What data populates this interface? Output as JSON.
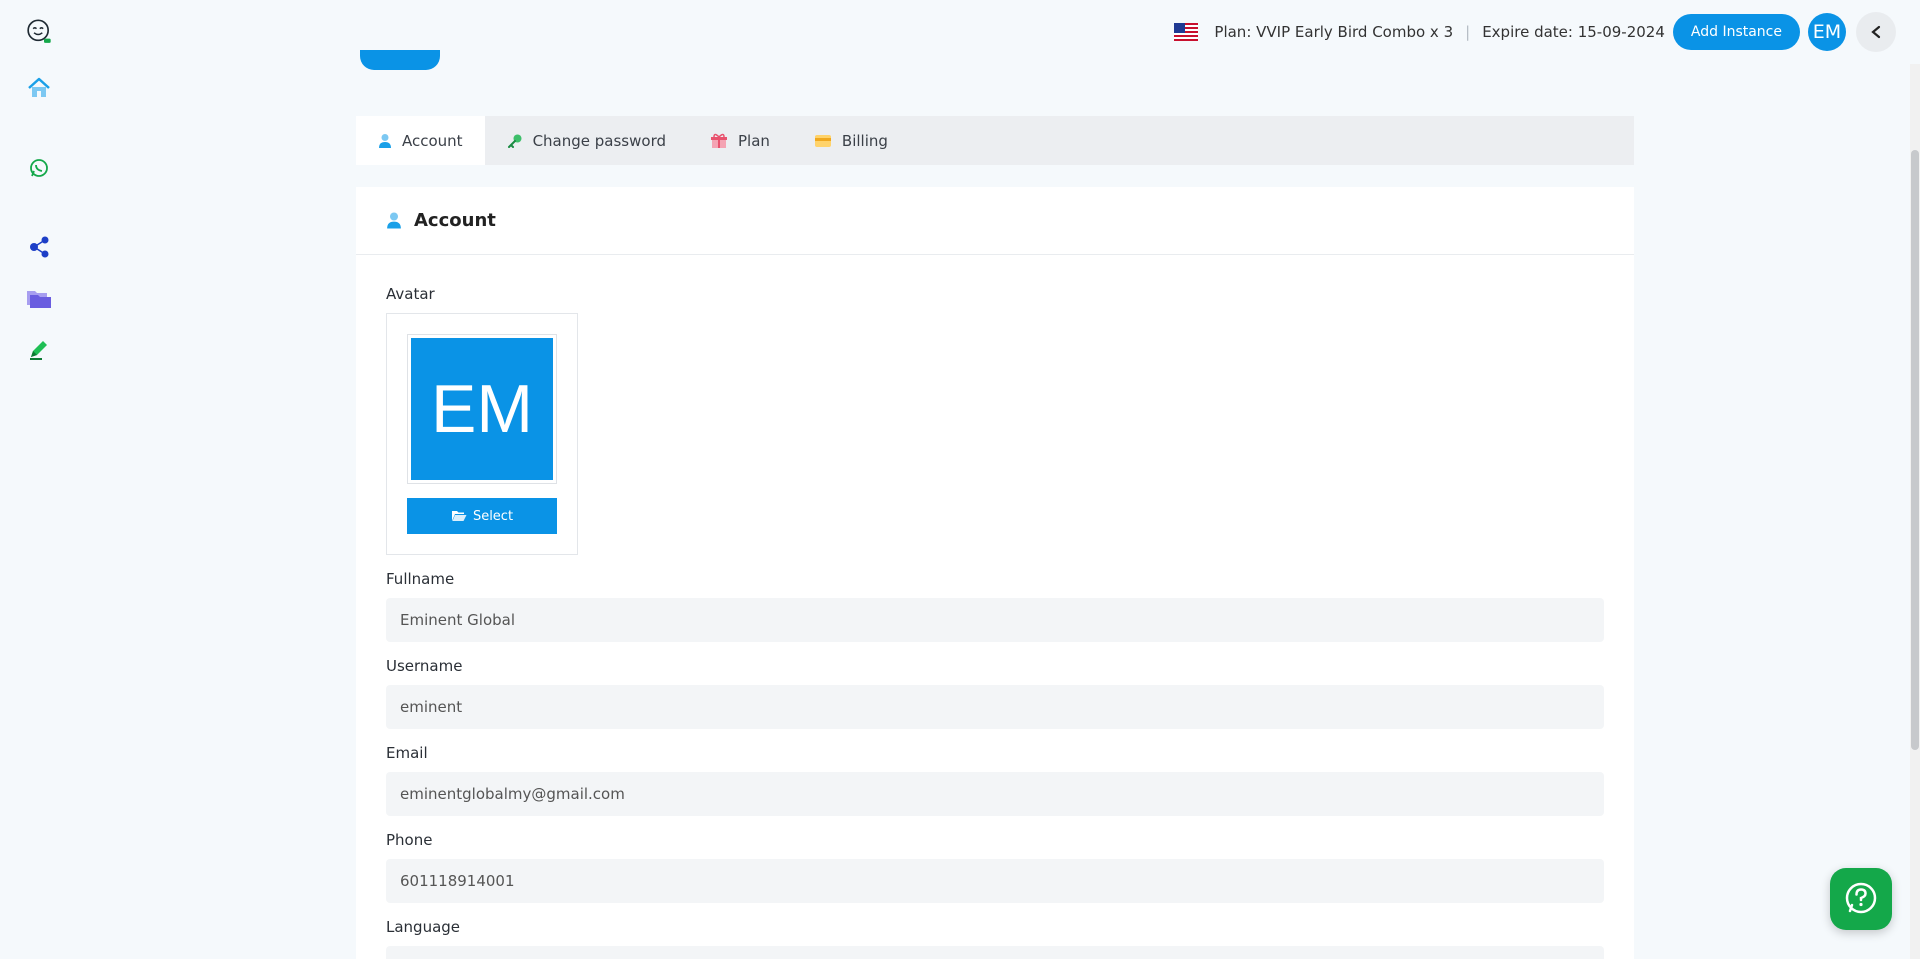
{
  "header": {
    "plan_label": "Plan: VVIP Early Bird Combo x 3",
    "separator": "|",
    "expire_label": "Expire date: 15-09-2024",
    "add_instance_label": "Add Instance",
    "avatar_initials": "EM"
  },
  "sidebar": {
    "items": [
      {
        "icon": "logo-icon"
      },
      {
        "icon": "home-icon"
      },
      {
        "icon": "whatsapp-icon"
      },
      {
        "icon": "share-icon"
      },
      {
        "icon": "folder-icon"
      },
      {
        "icon": "pen-icon"
      }
    ]
  },
  "tabs": [
    {
      "label": "Account",
      "icon": "user-icon",
      "active": true
    },
    {
      "label": "Change password",
      "icon": "key-icon",
      "active": false
    },
    {
      "label": "Plan",
      "icon": "gift-icon",
      "active": false
    },
    {
      "label": "Billing",
      "icon": "card-icon",
      "active": false
    }
  ],
  "card": {
    "title": "Account"
  },
  "form": {
    "avatar_label": "Avatar",
    "avatar_initials": "EM",
    "select_label": "Select",
    "fullname_label": "Fullname",
    "fullname_value": "Eminent Global",
    "username_label": "Username",
    "username_value": "eminent",
    "email_label": "Email",
    "email_value": "eminentglobalmy@gmail.com",
    "phone_label": "Phone",
    "phone_value": "601118914001",
    "language_label": "Language"
  },
  "colors": {
    "accent": "#0a93e6",
    "help_fab": "#14a84a"
  }
}
